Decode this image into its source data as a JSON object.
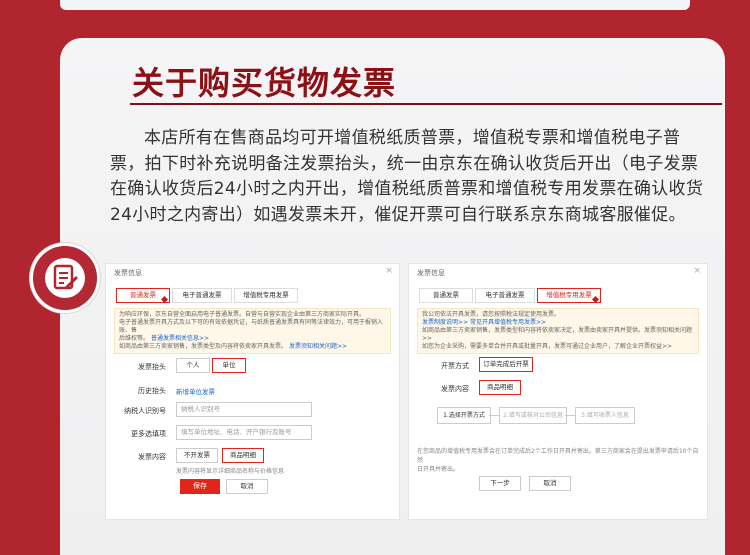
{
  "heading": "关于购买货物发票",
  "body_text": "本店所有在售商品均可开增值税纸质普票，增值税专票和增值税电子普票，拍下时补充说明备注发票抬头，统一由京东在确认收货后开出（电子发票在确认收货后24小时之内开出，增值税纸质普票和增值税专用发票在确认收货24小时之内寄出）如遇发票未开，催促开票可自行联系京东商城客服催促。",
  "left_panel": {
    "title": "发票信息",
    "close": "×",
    "tabs": [
      "普通发票",
      "电子普通发票",
      "增值税专用发票"
    ],
    "notice_lines": [
      "为响应环保，京东自营全面启用电子普通发票。自营与自营实现企业由第三方商家实际开具。",
      "电子普通发票开具方式及以下可的有效依据凭证，与纸质普通发票具有同等法律效力，可用于报销入账、售",
      "后维权等。"
    ],
    "notice_link1": "普通发票相关信息>>",
    "notice_line4": "如商品由第三方卖家销售，发票类型及内容将依卖家开具发票。",
    "notice_link2": "发票须知相关问题>>",
    "labels": {
      "title": "发票抬头",
      "history": "历史抬头",
      "taxid": "纳税人识别号",
      "more": "更多选填项",
      "content": "发票内容"
    },
    "title_options": [
      "个人",
      "单位"
    ],
    "history_link": "新增单位发票",
    "taxid_placeholder": "纳税人识别号",
    "more_placeholder": "填写单位地址、电话、开户银行及账号",
    "content_options": [
      "不开发票",
      "商品明细"
    ],
    "content_hint": "发票内容将显示详细商品名称与价格信息",
    "save": "保存",
    "cancel": "取消"
  },
  "right_panel": {
    "title": "发票信息",
    "close": "×",
    "tabs": [
      "普通发票",
      "电子普通发票",
      "增值税专用发票"
    ],
    "notice_lines": [
      "我公司依法开具发票，请您按照税法规定使用发票。",
      "发票制度说明>>   常见开具增值税专用发票>>",
      "如商品由第三方卖家销售，发票类型和内容将依卖家决定，发票由卖家开具并提供。发票须知相关问题>>",
      "如您为企业采购，需要多单合并开具或批量开具，发票可通过企业用户，了解企业开票权益>>"
    ],
    "labels": {
      "mode": "开票方式",
      "content": "发票内容"
    },
    "mode_value": "订单完成后开票",
    "content_value": "商品明细",
    "steps": [
      "1.选择开票方式",
      "2.填写或核对公司信息",
      "3.填写收票人信息"
    ],
    "footer_note_1": "在您商品的增值税专用发票会在订单完成后2个工作日开具并寄出。第三方商家会在提出发票申请后10个自然",
    "footer_note_2": "日开具并寄出。",
    "next": "下一步",
    "cancel": "取消"
  },
  "colors": {
    "brand_red": "#b1252e",
    "accent_red": "#e1251b",
    "heading_red": "#8b1116",
    "link_blue": "#1a66c8"
  },
  "icons": [
    "invoice-edit-icon"
  ]
}
